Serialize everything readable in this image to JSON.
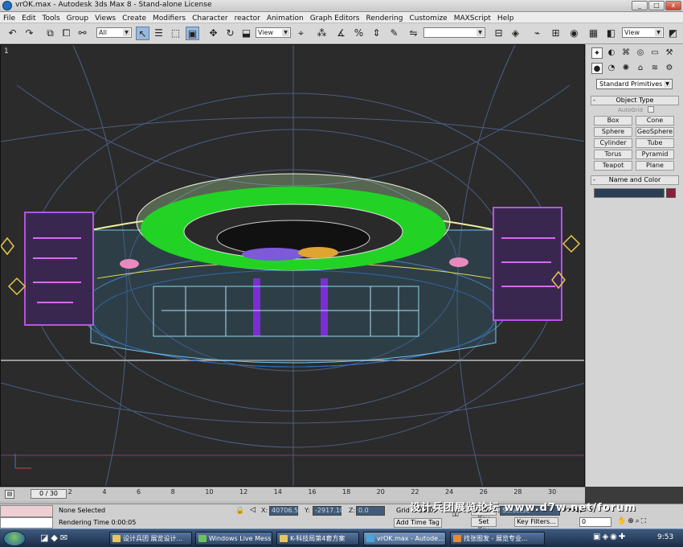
{
  "window": {
    "title": "vrOK.max - Autodesk 3ds Max 8 - Stand-alone License",
    "minimize": "_",
    "maximize": "□",
    "close": "x"
  },
  "menu": [
    "File",
    "Edit",
    "Tools",
    "Group",
    "Views",
    "Create",
    "Modifiers",
    "Character",
    "reactor",
    "Animation",
    "Graph Editors",
    "Rendering",
    "Customize",
    "MAXScript",
    "Help"
  ],
  "toolbar": {
    "selection_filter": "All",
    "ref_coord": "View",
    "named_selection": "",
    "render_type": "View"
  },
  "viewport": {
    "label": "1"
  },
  "command_panel": {
    "category": "Standard Primitives",
    "object_type_title": "Object Type",
    "autogrid_label": "AutoGrid",
    "buttons": [
      "Box",
      "Cone",
      "Sphere",
      "GeoSphere",
      "Cylinder",
      "Tube",
      "Torus",
      "Pyramid",
      "Teapot",
      "Plane"
    ],
    "name_color_title": "Name and Color",
    "color": "#8b1c3a"
  },
  "timeline": {
    "frame": "0 / 30",
    "ticks": [
      "0",
      "2",
      "4",
      "6",
      "8",
      "10",
      "12",
      "14",
      "16",
      "18",
      "20",
      "22",
      "24",
      "26",
      "28",
      "30"
    ]
  },
  "status": {
    "selection": "None Selected",
    "render_time": "Rendering Time  0:00:05",
    "x_label": "X:",
    "x_value": "40706.57",
    "y_label": "Y:",
    "y_value": "-2917.103",
    "z_label": "Z:",
    "z_value": "0.0",
    "grid": "Grid = 10.0",
    "add_time_tag": "Add Time Tag",
    "auto_key": "Auto Key",
    "selected": "Selected",
    "set_key": "Set Key",
    "key_filters": "Key Filters...",
    "frame_field": "0"
  },
  "taskbar": {
    "tasks": [
      "设计兵团 展览设计...",
      "Windows Live Mess...",
      "K-科技局第4套方案",
      "vrOK.max - Autode...",
      "找张图发 - 展览专业..."
    ],
    "clock": "9:53"
  },
  "watermark": "设计兵团展览论坛 www.d7w.net/forum"
}
